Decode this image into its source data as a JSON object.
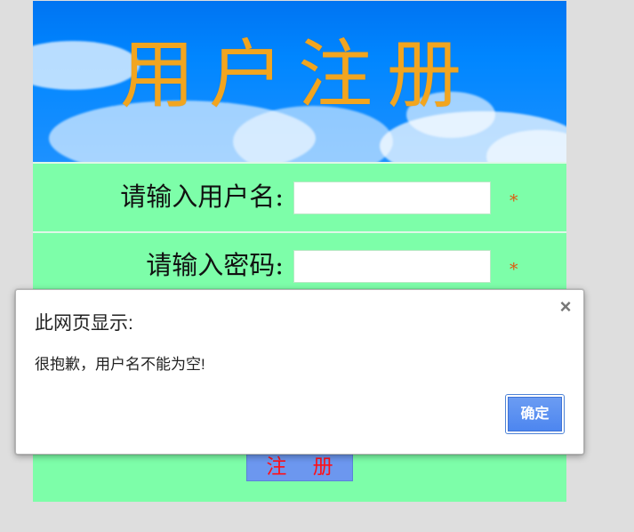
{
  "banner": {
    "title": "用户注册"
  },
  "form": {
    "username": {
      "label": "请输入用户名:",
      "value": "",
      "placeholder": "",
      "required_mark": "*"
    },
    "password": {
      "label": "请输入密码:",
      "value": "",
      "placeholder": "",
      "required_mark": "*"
    },
    "submit_label": "注 册"
  },
  "dialog": {
    "title": "此网页显示:",
    "message": "很抱歉，用户名不能为空!",
    "ok_label": "确定",
    "close_icon": "×"
  },
  "colors": {
    "page_background": "#dedede",
    "form_background": "#7dfea9",
    "banner_sky": "#0086ff",
    "title": "#f2a51f",
    "required_mark": "#df5a10",
    "submit_button": "#6c97ef",
    "submit_text": "#ff1018",
    "dialog_button": "#4d86f0"
  },
  "icons": {
    "close": "close-icon",
    "required": "required-asterisk"
  }
}
